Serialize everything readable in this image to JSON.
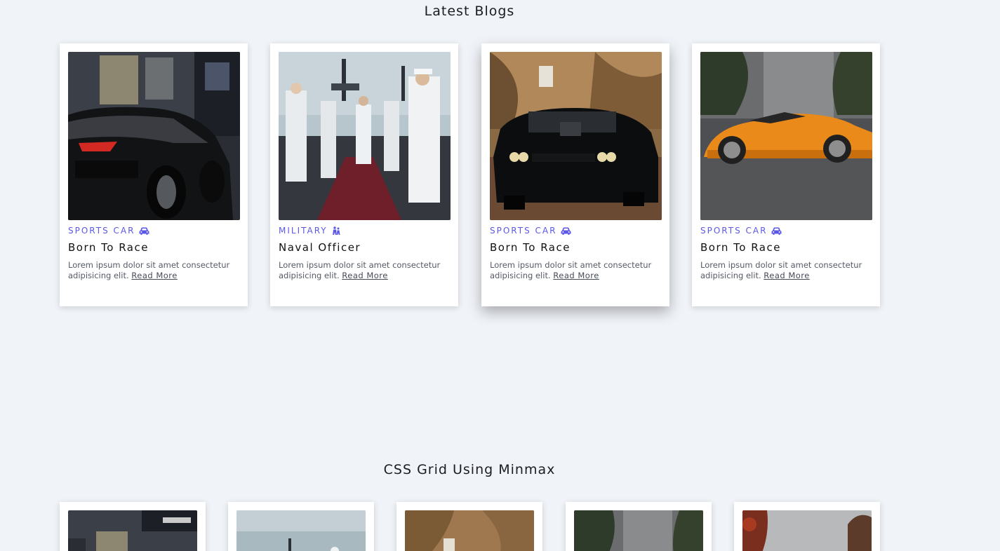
{
  "latest_blogs": {
    "heading": "Latest Blogs",
    "cards": [
      {
        "category": "Sports Car",
        "category_icon": "car-icon",
        "title": "Born To Race",
        "description": "Lorem ipsum dolor sit amet consectetur adipisicing elit.",
        "link_label": "Read More",
        "image": "black-sports-car-photo"
      },
      {
        "category": "Military",
        "category_icon": "people-icon",
        "title": "Naval Officer",
        "description": "Lorem ipsum dolor sit amet consectetur adipisicing elit.",
        "link_label": "Read More",
        "image": "naval-officers-photo"
      },
      {
        "category": "Sports Car",
        "category_icon": "car-icon",
        "title": "Born To Race",
        "description": "Lorem ipsum dolor sit amet consectetur adipisicing elit.",
        "link_label": "Read More",
        "image": "black-muscle-car-photo"
      },
      {
        "category": "Sports Car",
        "category_icon": "car-icon",
        "title": "Born To Race",
        "description": "Lorem ipsum dolor sit amet consectetur adipisicing elit.",
        "link_label": "Read More",
        "image": "orange-sports-car-photo"
      }
    ]
  },
  "minmax_grid": {
    "heading": "CSS Grid Using Minmax",
    "cards": [
      {
        "image": "black-sports-car-photo"
      },
      {
        "image": "naval-officers-photo"
      },
      {
        "image": "black-muscle-car-photo"
      },
      {
        "image": "orange-sports-car-photo"
      },
      {
        "image": "autumn-trees-photo"
      }
    ]
  },
  "colors": {
    "background": "#f0f3f8",
    "accent": "#5b58e6",
    "card": "#ffffff"
  }
}
